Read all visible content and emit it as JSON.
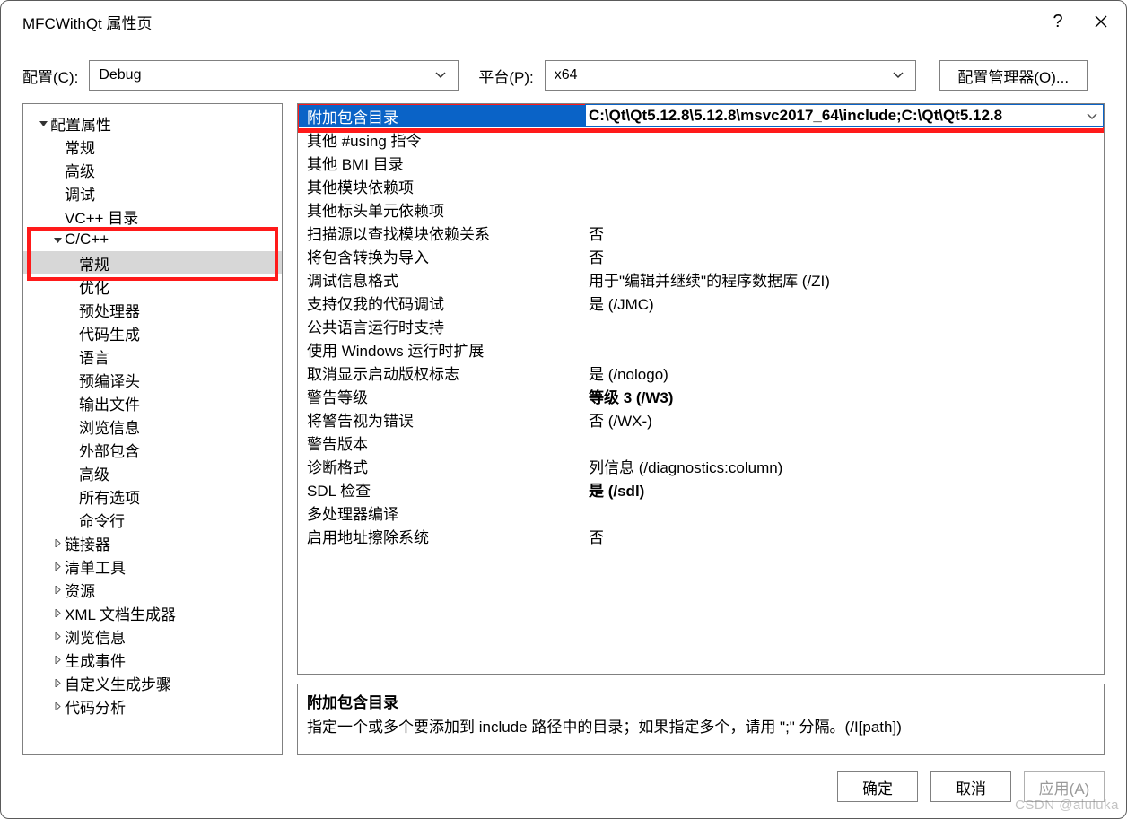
{
  "window": {
    "title": "MFCWithQt 属性页",
    "help_tooltip": "?",
    "close_tooltip": "×"
  },
  "toprow": {
    "config_label": "配置(C):",
    "config_value": "Debug",
    "platform_label": "平台(P):",
    "platform_value": "x64",
    "cfgmgr_label": "配置管理器(O)..."
  },
  "tree": [
    {
      "label": "配置属性",
      "level": 0,
      "expanded": true,
      "leaf": false
    },
    {
      "label": "常规",
      "level": 1,
      "leaf": true
    },
    {
      "label": "高级",
      "level": 1,
      "leaf": true
    },
    {
      "label": "调试",
      "level": 1,
      "leaf": true
    },
    {
      "label": "VC++ 目录",
      "level": 1,
      "leaf": true
    },
    {
      "label": "C/C++",
      "level": 1,
      "expanded": true,
      "leaf": false
    },
    {
      "label": "常规",
      "level": 2,
      "leaf": true,
      "selected": true
    },
    {
      "label": "优化",
      "level": 2,
      "leaf": true
    },
    {
      "label": "预处理器",
      "level": 2,
      "leaf": true
    },
    {
      "label": "代码生成",
      "level": 2,
      "leaf": true
    },
    {
      "label": "语言",
      "level": 2,
      "leaf": true
    },
    {
      "label": "预编译头",
      "level": 2,
      "leaf": true
    },
    {
      "label": "输出文件",
      "level": 2,
      "leaf": true
    },
    {
      "label": "浏览信息",
      "level": 2,
      "leaf": true
    },
    {
      "label": "外部包含",
      "level": 2,
      "leaf": true
    },
    {
      "label": "高级",
      "level": 2,
      "leaf": true
    },
    {
      "label": "所有选项",
      "level": 2,
      "leaf": true
    },
    {
      "label": "命令行",
      "level": 2,
      "leaf": true
    },
    {
      "label": "链接器",
      "level": 1,
      "collapsed": true,
      "leaf": false
    },
    {
      "label": "清单工具",
      "level": 1,
      "collapsed": true,
      "leaf": false
    },
    {
      "label": "资源",
      "level": 1,
      "collapsed": true,
      "leaf": false
    },
    {
      "label": "XML 文档生成器",
      "level": 1,
      "collapsed": true,
      "leaf": false
    },
    {
      "label": "浏览信息",
      "level": 1,
      "collapsed": true,
      "leaf": false
    },
    {
      "label": "生成事件",
      "level": 1,
      "collapsed": true,
      "leaf": false
    },
    {
      "label": "自定义生成步骤",
      "level": 1,
      "collapsed": true,
      "leaf": false
    },
    {
      "label": "代码分析",
      "level": 1,
      "collapsed": true,
      "leaf": false
    }
  ],
  "grid": [
    {
      "key": "附加包含目录",
      "val": "C:\\Qt\\Qt5.12.8\\5.12.8\\msvc2017_64\\include;C:\\Qt\\Qt5.12.8",
      "bold": true,
      "selected": true
    },
    {
      "key": "其他 #using 指令",
      "val": ""
    },
    {
      "key": "其他 BMI 目录",
      "val": ""
    },
    {
      "key": "其他模块依赖项",
      "val": ""
    },
    {
      "key": "其他标头单元依赖项",
      "val": ""
    },
    {
      "key": "扫描源以查找模块依赖关系",
      "val": "否"
    },
    {
      "key": "将包含转换为导入",
      "val": "否"
    },
    {
      "key": "调试信息格式",
      "val": "用于\"编辑并继续\"的程序数据库 (/ZI)"
    },
    {
      "key": "支持仅我的代码调试",
      "val": "是 (/JMC)"
    },
    {
      "key": "公共语言运行时支持",
      "val": ""
    },
    {
      "key": "使用 Windows 运行时扩展",
      "val": ""
    },
    {
      "key": "取消显示启动版权标志",
      "val": "是 (/nologo)"
    },
    {
      "key": "警告等级",
      "val": "等级 3 (/W3)",
      "bold": true
    },
    {
      "key": "将警告视为错误",
      "val": "否 (/WX-)"
    },
    {
      "key": "警告版本",
      "val": ""
    },
    {
      "key": "诊断格式",
      "val": "列信息 (/diagnostics:column)"
    },
    {
      "key": "SDL 检查",
      "val": "是 (/sdl)",
      "bold": true
    },
    {
      "key": "多处理器编译",
      "val": ""
    },
    {
      "key": "启用地址擦除系统",
      "val": "否"
    }
  ],
  "desc": {
    "title": "附加包含目录",
    "body": "指定一个或多个要添加到 include 路径中的目录；如果指定多个，请用 \";\" 分隔。(/I[path])"
  },
  "footer": {
    "ok": "确定",
    "cancel": "取消",
    "apply": "应用(A)"
  },
  "watermark": "CSDN @aluluka"
}
